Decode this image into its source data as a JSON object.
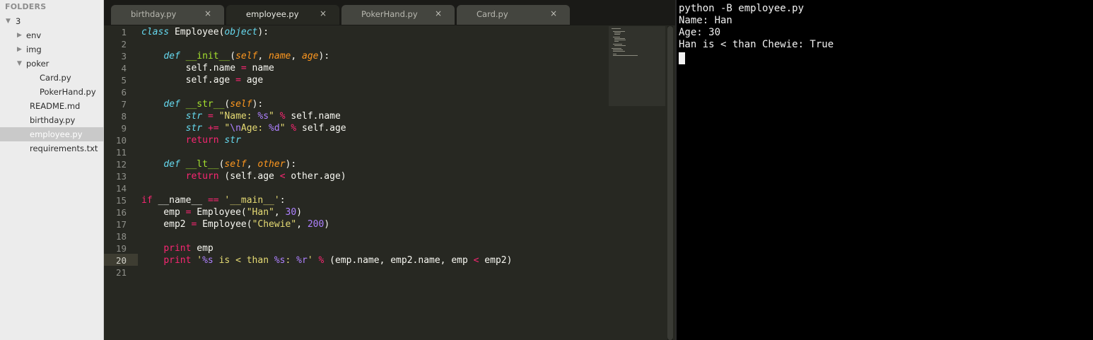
{
  "sidebar": {
    "header": "FOLDERS",
    "items": [
      {
        "label": "3",
        "depth": 0,
        "expanded": true,
        "folder": true
      },
      {
        "label": "env",
        "depth": 1,
        "expanded": false,
        "folder": true
      },
      {
        "label": "img",
        "depth": 1,
        "expanded": false,
        "folder": true
      },
      {
        "label": "poker",
        "depth": 1,
        "expanded": true,
        "folder": true
      },
      {
        "label": "Card.py",
        "depth": 2,
        "folder": false
      },
      {
        "label": "PokerHand.py",
        "depth": 2,
        "folder": false
      },
      {
        "label": "README.md",
        "depth": 1,
        "folder": false
      },
      {
        "label": "birthday.py",
        "depth": 1,
        "folder": false
      },
      {
        "label": "employee.py",
        "depth": 1,
        "folder": false,
        "selected": true
      },
      {
        "label": "requirements.txt",
        "depth": 1,
        "folder": false
      }
    ]
  },
  "tabs": [
    {
      "label": "birthday.py",
      "active": false
    },
    {
      "label": "employee.py",
      "active": true
    },
    {
      "label": "PokerHand.py",
      "active": false
    },
    {
      "label": "Card.py",
      "active": false
    }
  ],
  "tab_close_glyph": "×",
  "editor": {
    "current_line": 20,
    "lines": [
      [
        [
          "sc",
          "class"
        ],
        [
          "t",
          " Employee("
        ],
        [
          "bi",
          "object"
        ],
        [
          "t",
          "):"
        ]
      ],
      [],
      [
        [
          "t",
          "    "
        ],
        [
          "sc",
          "def"
        ],
        [
          "t",
          " "
        ],
        [
          "fn",
          "__init__"
        ],
        [
          "t",
          "("
        ],
        [
          "arg",
          "self"
        ],
        [
          "t",
          ", "
        ],
        [
          "arg",
          "name"
        ],
        [
          "t",
          ", "
        ],
        [
          "arg",
          "age"
        ],
        [
          "t",
          "):"
        ]
      ],
      [
        [
          "t",
          "        self.name "
        ],
        [
          "kw",
          "="
        ],
        [
          "t",
          " name"
        ]
      ],
      [
        [
          "t",
          "        self.age "
        ],
        [
          "kw",
          "="
        ],
        [
          "t",
          " age"
        ]
      ],
      [],
      [
        [
          "t",
          "    "
        ],
        [
          "sc",
          "def"
        ],
        [
          "t",
          " "
        ],
        [
          "fn",
          "__str__"
        ],
        [
          "t",
          "("
        ],
        [
          "arg",
          "self"
        ],
        [
          "t",
          "):"
        ]
      ],
      [
        [
          "t",
          "        "
        ],
        [
          "bi",
          "str"
        ],
        [
          "t",
          " "
        ],
        [
          "kw",
          "="
        ],
        [
          "t",
          " "
        ],
        [
          "str",
          "\"Name: "
        ],
        [
          "esc",
          "%s"
        ],
        [
          "str",
          "\""
        ],
        [
          "t",
          " "
        ],
        [
          "kw",
          "%"
        ],
        [
          "t",
          " self.name"
        ]
      ],
      [
        [
          "t",
          "        "
        ],
        [
          "bi",
          "str"
        ],
        [
          "t",
          " "
        ],
        [
          "kw",
          "+="
        ],
        [
          "t",
          " "
        ],
        [
          "str",
          "\""
        ],
        [
          "esc",
          "\\n"
        ],
        [
          "str",
          "Age: "
        ],
        [
          "esc",
          "%d"
        ],
        [
          "str",
          "\""
        ],
        [
          "t",
          " "
        ],
        [
          "kw",
          "%"
        ],
        [
          "t",
          " self.age"
        ]
      ],
      [
        [
          "t",
          "        "
        ],
        [
          "kw",
          "return"
        ],
        [
          "t",
          " "
        ],
        [
          "bi",
          "str"
        ]
      ],
      [],
      [
        [
          "t",
          "    "
        ],
        [
          "sc",
          "def"
        ],
        [
          "t",
          " "
        ],
        [
          "fn",
          "__lt__"
        ],
        [
          "t",
          "("
        ],
        [
          "arg",
          "self"
        ],
        [
          "t",
          ", "
        ],
        [
          "arg",
          "other"
        ],
        [
          "t",
          "):"
        ]
      ],
      [
        [
          "t",
          "        "
        ],
        [
          "kw",
          "return"
        ],
        [
          "t",
          " (self.age "
        ],
        [
          "kw",
          "<"
        ],
        [
          "t",
          " other.age)"
        ]
      ],
      [],
      [
        [
          "kw",
          "if"
        ],
        [
          "t",
          " __name__ "
        ],
        [
          "kw",
          "=="
        ],
        [
          "t",
          " "
        ],
        [
          "str",
          "'__main__'"
        ],
        [
          "t",
          ":"
        ]
      ],
      [
        [
          "t",
          "    emp "
        ],
        [
          "kw",
          "="
        ],
        [
          "t",
          " Employee("
        ],
        [
          "str",
          "\"Han\""
        ],
        [
          "t",
          ", "
        ],
        [
          "num",
          "30"
        ],
        [
          "t",
          ")"
        ]
      ],
      [
        [
          "t",
          "    emp2 "
        ],
        [
          "kw",
          "="
        ],
        [
          "t",
          " Employee("
        ],
        [
          "str",
          "\"Chewie\""
        ],
        [
          "t",
          ", "
        ],
        [
          "num",
          "200"
        ],
        [
          "t",
          ")"
        ]
      ],
      [],
      [
        [
          "t",
          "    "
        ],
        [
          "kw",
          "print"
        ],
        [
          "t",
          " emp"
        ]
      ],
      [
        [
          "t",
          "    "
        ],
        [
          "kw",
          "print"
        ],
        [
          "t",
          " "
        ],
        [
          "str",
          "'"
        ],
        [
          "esc",
          "%s"
        ],
        [
          "str",
          " is < than "
        ],
        [
          "esc",
          "%s"
        ],
        [
          "str",
          ": "
        ],
        [
          "esc",
          "%r"
        ],
        [
          "str",
          "'"
        ],
        [
          "t",
          " "
        ],
        [
          "kw",
          "%"
        ],
        [
          "t",
          " (emp.name, emp2.name, emp "
        ],
        [
          "kw",
          "<"
        ],
        [
          "t",
          " emp2)"
        ]
      ],
      []
    ]
  },
  "terminal": {
    "lines": [
      "python -B employee.py",
      "Name: Han",
      "Age: 30",
      "Han is < than Chewie: True"
    ]
  }
}
